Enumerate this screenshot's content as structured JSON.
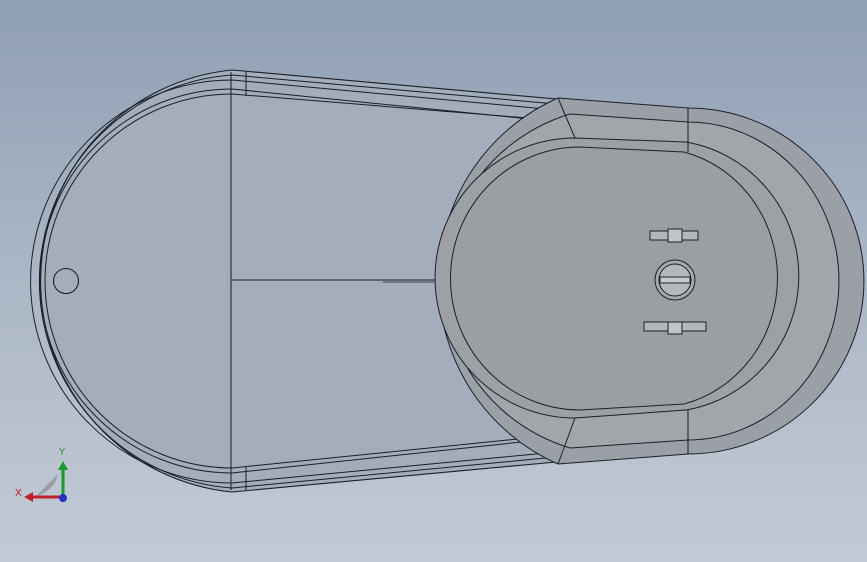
{
  "viewport": {
    "background_top": "#8f9fb4",
    "background_bottom": "#c3cad5"
  },
  "model": {
    "edge_color": "#1b1f26",
    "body_fill": "#a3adbb",
    "cap_fill": "#9aa0a6",
    "cap_face_fill": "#9c9fa2",
    "cap_highlight": "#b4b8bc"
  },
  "triad": {
    "x_label": "X",
    "y_label": "Y",
    "x_color": "#c0202a",
    "y_color": "#1a9a2a",
    "z_color": "#2030c0"
  }
}
